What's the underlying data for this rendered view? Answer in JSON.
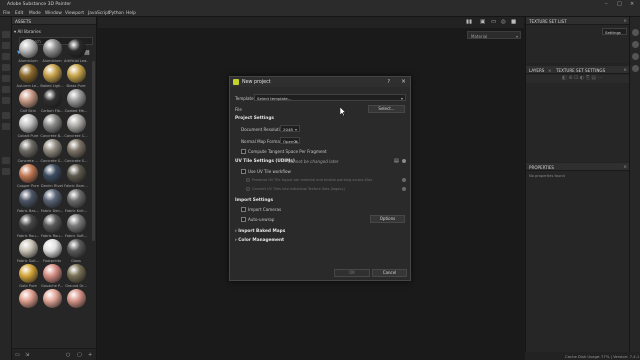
{
  "window": {
    "title": "Adobe Substance 3D Painter"
  },
  "menu": [
    "File",
    "Edit",
    "Mode",
    "Window",
    "Viewport",
    "JavaScript",
    "Python",
    "Help"
  ],
  "assets": {
    "header": "ASSETS",
    "breadcrumb": "All libraries",
    "search_placeholder": "Search",
    "materials": [
      {
        "name": "Aluminium",
        "color": "#b9b9b9"
      },
      {
        "name": "Aluminium",
        "color": "#8f8f8f"
      },
      {
        "name": "Artificial Lea...",
        "color": "#2a2a2a"
      },
      {
        "name": "Autumn Le...",
        "color": "#8d6a2c"
      },
      {
        "name": "Baked Ligh...",
        "color": "#c7a24a"
      },
      {
        "name": "Brass Pure",
        "color": "#c8a64a"
      },
      {
        "name": "Calf Skin",
        "color": "#c99a87"
      },
      {
        "name": "Carbon Fib...",
        "color": "#303030"
      },
      {
        "name": "Coated Me...",
        "color": "#9a9a9a"
      },
      {
        "name": "Cobalt Pure",
        "color": "#c3c3c3"
      },
      {
        "name": "Concrete B...",
        "color": "#8a8a88"
      },
      {
        "name": "Concrete C...",
        "color": "#b0aeaa"
      },
      {
        "name": "Concrete ...",
        "color": "#6f6c66"
      },
      {
        "name": "Concrete S...",
        "color": "#908a80"
      },
      {
        "name": "Concrete S...",
        "color": "#7e7467"
      },
      {
        "name": "Copper Pure",
        "color": "#c47a55"
      },
      {
        "name": "Denim Rivet",
        "color": "#3e4d62"
      },
      {
        "name": "Fabric Bam...",
        "color": "#5f5a4e"
      },
      {
        "name": "Fabric Bas...",
        "color": "#4d5666"
      },
      {
        "name": "Fabric Den...",
        "color": "#5a6475"
      },
      {
        "name": "Fabric Knit...",
        "color": "#6b6b6b"
      },
      {
        "name": "Fabric Rou...",
        "color": "#474747"
      },
      {
        "name": "Fabric Rou...",
        "color": "#5b5b5b"
      },
      {
        "name": "Fabric Soft...",
        "color": "#7a7a7a"
      },
      {
        "name": "Fabric Suit...",
        "color": "#c9c3b6"
      },
      {
        "name": "Footprints",
        "color": "#e0e0e0"
      },
      {
        "name": "Glass",
        "color": "#5a5a5a"
      },
      {
        "name": "Gold Pure",
        "color": "#d4a63b"
      },
      {
        "name": "Gouache P...",
        "color": "#d78e85"
      },
      {
        "name": "Ground Gr...",
        "color": "#7a7156"
      },
      {
        "name": "",
        "color": "#e1a090"
      },
      {
        "name": "",
        "color": "#e4a799"
      },
      {
        "name": "",
        "color": "#d8968a"
      }
    ]
  },
  "viewport": {
    "material_dropdown": "Material"
  },
  "right": {
    "texture_set_list": "TEXTURE SET LIST",
    "settings": "Settings",
    "layers": "LAYERS",
    "texture_set_settings": "TEXTURE SET SETTINGS",
    "properties": "PROPERTIES",
    "no_selection": "No properties found"
  },
  "status": {
    "cache": "Cache Disk Usage:",
    "version": "77% | Version: 7.4.1"
  },
  "dialog": {
    "title": "New project",
    "help": "?",
    "close": "×",
    "template_label": "Template",
    "template_value": "Select template...",
    "file_label": "File",
    "file_button": "Select...",
    "project_settings": "Project Settings",
    "doc_res_label": "Document Resolution",
    "doc_res_value": "2048",
    "normal_fmt_label": "Normal Map Format",
    "normal_fmt_value": "OpenGL",
    "tangent_label": "Compute Tangent Space Per Fragment",
    "uv_settings": "UV Tile Settings (UDIMs)",
    "uv_note": "- Cannot be changed later",
    "use_uv_label": "Use UV Tile workflow",
    "uv_opt1": "Preserve UV Tile layout per material and enable painting across tiles",
    "uv_opt2": "Convert UV Tiles into individual Texture Sets (legacy)",
    "import_settings": "Import Settings",
    "import_cameras": "Import Cameras",
    "auto_unwrap": "Auto-unwrap",
    "options_button": "Options",
    "import_baked": "Import Baked Maps",
    "color_mgmt": "Color Management",
    "ok_button": "OK",
    "cancel_button": "Cancel"
  }
}
